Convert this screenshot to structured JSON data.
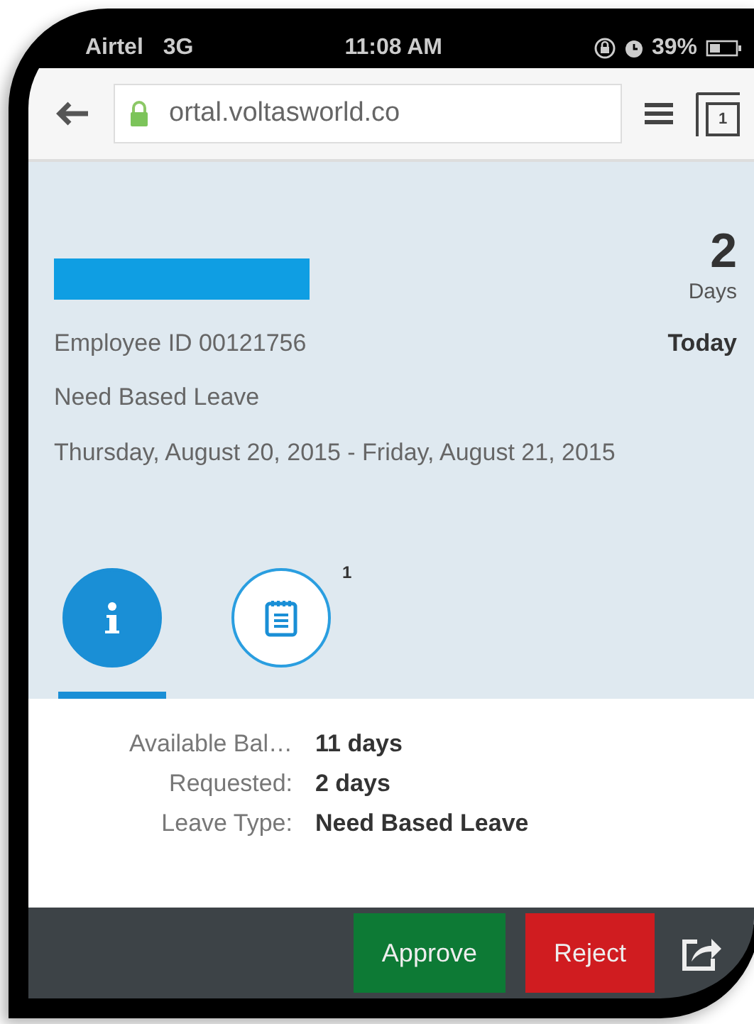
{
  "status_bar": {
    "carrier": "Airtel",
    "network": "3G",
    "time": "11:08 AM",
    "battery": "39%"
  },
  "browser": {
    "url": "ortal.voltasworld.co",
    "secure": true,
    "tab_count": "1"
  },
  "request": {
    "days": "2",
    "days_label": "Days",
    "employee_id": "Employee ID 00121756",
    "when": "Today",
    "leave_type": "Need Based Leave",
    "dates": "Thursday, August 20, 2015 - Friday, August 21, 2015"
  },
  "tabs": [
    {
      "kind": "info",
      "selected": true
    },
    {
      "kind": "notes",
      "selected": false,
      "count": "1"
    }
  ],
  "details": [
    {
      "label": "Available Bal…",
      "value": "11 days"
    },
    {
      "label": "Requested:",
      "value": "2 days"
    },
    {
      "label": "Leave Type:",
      "value": "Need Based Leave"
    }
  ],
  "footer": {
    "buttons": [
      {
        "label": "Approve",
        "kind": "accept"
      },
      {
        "label": "Reject",
        "kind": "reject"
      }
    ]
  }
}
